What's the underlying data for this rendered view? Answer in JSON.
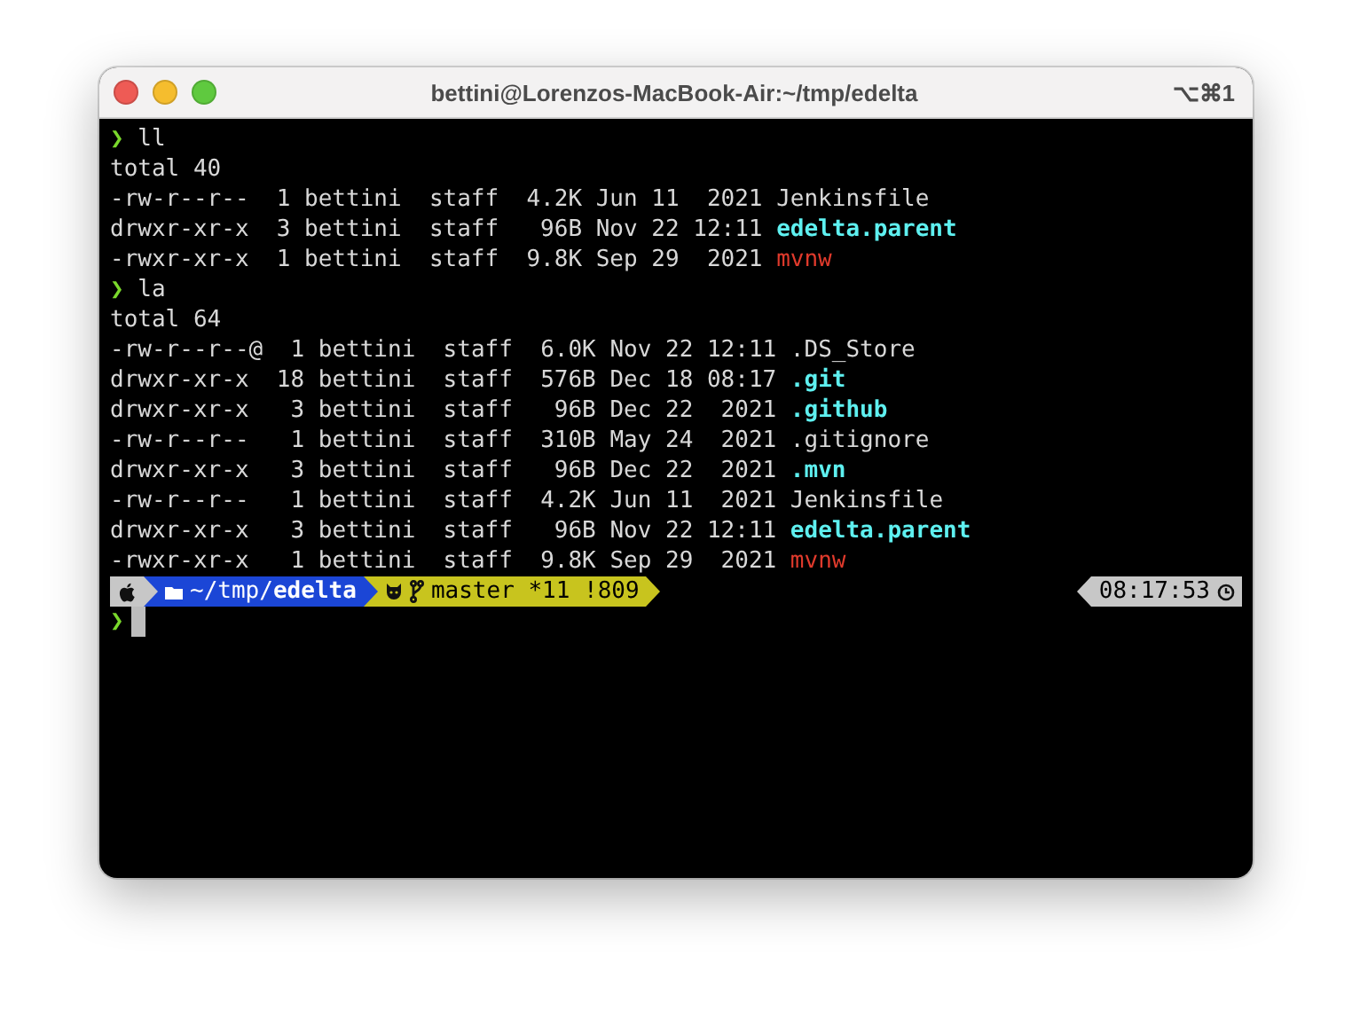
{
  "window": {
    "title": "bettini@Lorenzos-MacBook-Air:~/tmp/edelta",
    "shortcut": "⌥⌘1"
  },
  "blocks": [
    {
      "prompt": "❯",
      "command": "ll",
      "total": "total 40",
      "entries": [
        {
          "mode": "-rw-r--r--",
          "links": "1",
          "owner": "bettini",
          "group": "staff",
          "size": "4.2K",
          "date": "Jun 11  2021",
          "name": "Jenkinsfile",
          "kind": "file"
        },
        {
          "mode": "drwxr-xr-x",
          "links": "3",
          "owner": "bettini",
          "group": "staff",
          "size": "96B",
          "date": "Nov 22 12:11",
          "name": "edelta.parent",
          "kind": "dir"
        },
        {
          "mode": "-rwxr-xr-x",
          "links": "1",
          "owner": "bettini",
          "group": "staff",
          "size": "9.8K",
          "date": "Sep 29  2021",
          "name": "mvnw",
          "kind": "exec"
        }
      ]
    },
    {
      "prompt": "❯",
      "command": "la",
      "total": "total 64",
      "entries": [
        {
          "mode": "-rw-r--r--@",
          "links": "1",
          "owner": "bettini",
          "group": "staff",
          "size": "6.0K",
          "date": "Nov 22 12:11",
          "name": ".DS_Store",
          "kind": "file"
        },
        {
          "mode": "drwxr-xr-x",
          "links": "18",
          "owner": "bettini",
          "group": "staff",
          "size": "576B",
          "date": "Dec 18 08:17",
          "name": ".git",
          "kind": "dir"
        },
        {
          "mode": "drwxr-xr-x",
          "links": "3",
          "owner": "bettini",
          "group": "staff",
          "size": "96B",
          "date": "Dec 22  2021",
          "name": ".github",
          "kind": "dir"
        },
        {
          "mode": "-rw-r--r--",
          "links": "1",
          "owner": "bettini",
          "group": "staff",
          "size": "310B",
          "date": "May 24  2021",
          "name": ".gitignore",
          "kind": "file"
        },
        {
          "mode": "drwxr-xr-x",
          "links": "3",
          "owner": "bettini",
          "group": "staff",
          "size": "96B",
          "date": "Dec 22  2021",
          "name": ".mvn",
          "kind": "dir"
        },
        {
          "mode": "-rw-r--r--",
          "links": "1",
          "owner": "bettini",
          "group": "staff",
          "size": "4.2K",
          "date": "Jun 11  2021",
          "name": "Jenkinsfile",
          "kind": "file"
        },
        {
          "mode": "drwxr-xr-x",
          "links": "3",
          "owner": "bettini",
          "group": "staff",
          "size": "96B",
          "date": "Nov 22 12:11",
          "name": "edelta.parent",
          "kind": "dir"
        },
        {
          "mode": "-rwxr-xr-x",
          "links": "1",
          "owner": "bettini",
          "group": "staff",
          "size": "9.8K",
          "date": "Sep 29  2021",
          "name": "mvnw",
          "kind": "exec"
        }
      ]
    }
  ],
  "status_line": {
    "path": "~/tmp/**edelta**",
    "git": "master *11 !809",
    "time": "08:17:53"
  },
  "input_prompt": {
    "prompt": "❯"
  }
}
